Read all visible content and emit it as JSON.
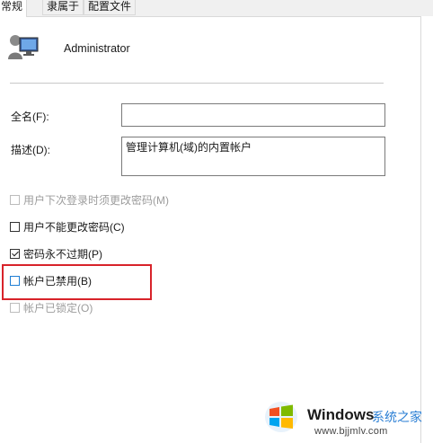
{
  "tabs": [
    {
      "label": "常规",
      "active": true
    },
    {
      "label": "隶属于",
      "active": false
    },
    {
      "label": "配置文件",
      "active": false
    }
  ],
  "user": {
    "name": "Administrator",
    "icon": "user-monitor-icon"
  },
  "fields": {
    "fullname_label": "全名(F):",
    "fullname_value": "",
    "description_label": "描述(D):",
    "description_value": "管理计算机(域)的内置帐户"
  },
  "checkboxes": [
    {
      "label": "用户下次登录时须更改密码(M)",
      "checked": false,
      "disabled": true
    },
    {
      "label": "用户不能更改密码(C)",
      "checked": false,
      "disabled": false
    },
    {
      "label": "密码永不过期(P)",
      "checked": true,
      "disabled": false
    },
    {
      "label": "帐户已禁用(B)",
      "checked": false,
      "disabled": false
    },
    {
      "label": "帐户已锁定(O)",
      "checked": false,
      "disabled": true
    }
  ],
  "highlight_color": "#d8232a",
  "watermark": {
    "title": "Windows",
    "subtitle": "系统之家",
    "url": "www.bjjmlv.com",
    "logo": "windows-flag-icon"
  }
}
